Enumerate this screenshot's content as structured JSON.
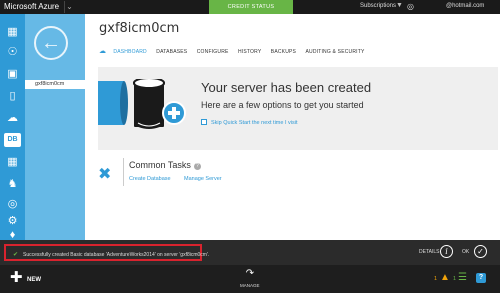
{
  "topbar": {
    "brand": "Microsoft Azure",
    "credit_status": "CREDIT STATUS",
    "subscriptions": "Subscriptions",
    "email": "@hotmail.com"
  },
  "sidebar": {
    "icons": [
      "grid-icon",
      "globe-icon",
      "monitor-icon",
      "mobile-icon",
      "cloud-services-icon",
      "sql-database-icon",
      "table-icon",
      "hdinsight-icon",
      "media-icon",
      "settings-icon",
      "active-directory-icon"
    ],
    "selected": 5
  },
  "subnav": {
    "item": "gxf8icm0cm"
  },
  "main": {
    "title": "gxf8icm0cm",
    "tabs": [
      "DASHBOARD",
      "DATABASES",
      "CONFIGURE",
      "HISTORY",
      "BACKUPS",
      "AUDITING & SECURITY"
    ],
    "active_tab": 0
  },
  "banner": {
    "heading": "Your server has been created",
    "subheading": "Here are a few options to get you started",
    "skip_label": "Skip Quick Start the next time I visit"
  },
  "tasks": {
    "title": "Common Tasks",
    "links": [
      "Create Database",
      "Manage Server"
    ]
  },
  "notification": {
    "message": "Successfully created Basic database 'AdventureWorks2014' on server 'gxf8icm0cm'.",
    "details_label": "DETAILS",
    "ok_label": "OK"
  },
  "cmdbar": {
    "new_label": "NEW",
    "manage_label": "MANAGE",
    "warning_count": "1",
    "list_count": "1"
  },
  "colors": {
    "accent": "#2f9ad6",
    "subnav": "#66b9e6",
    "credit": "#68b546",
    "highlight": "#d9232e"
  }
}
